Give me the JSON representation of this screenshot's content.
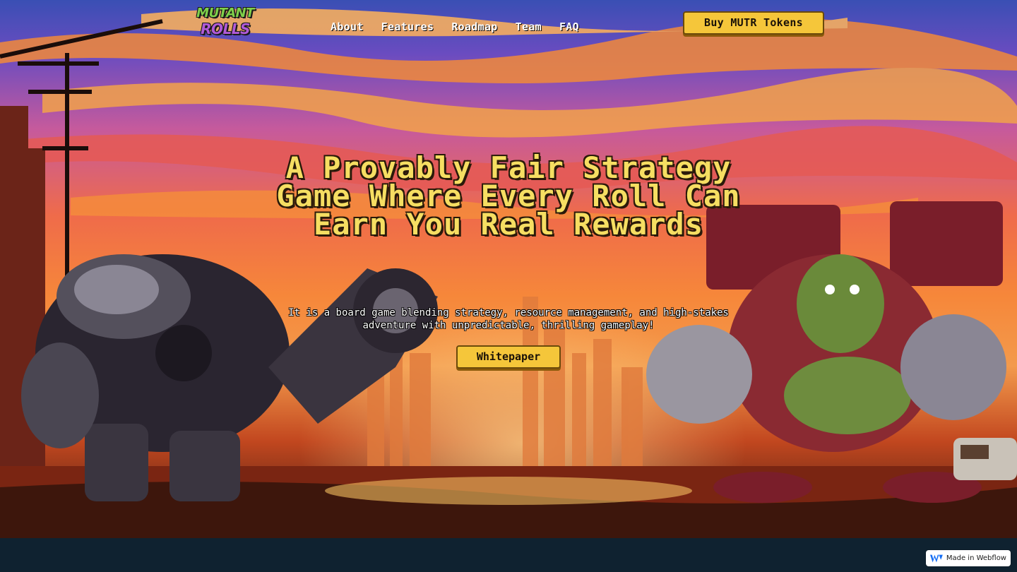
{
  "brand": {
    "logo_line1": "MUTANT",
    "logo_line2": "ROLLS"
  },
  "nav": {
    "links": [
      "About",
      "Features",
      "Roadmap",
      "Team",
      "FAQ"
    ],
    "cta_label": "Buy MUTR Tokens"
  },
  "hero": {
    "headline": "A Provably Fair Strategy Game Where Every Roll Can Earn You Real Rewards",
    "subtext": "It is a board game blending strategy, resource management, and high-stakes adventure with unpredictable, thrilling gameplay!",
    "cta_label": "Whitepaper"
  },
  "badge": {
    "label": "Made in Webflow",
    "icon": "webflow-logo-icon"
  },
  "colors": {
    "accent": "#f5c63a",
    "headline": "#f6de62",
    "footer_band": "#0f2230"
  }
}
